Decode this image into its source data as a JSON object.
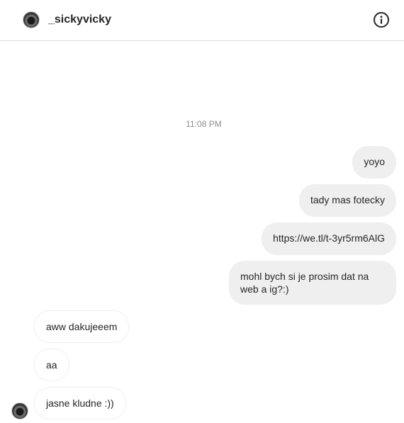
{
  "header": {
    "username": "_sickyvicky",
    "avatar_icon": "profile-avatar",
    "info_icon": "info-circle-icon"
  },
  "thread": {
    "timestamp": "11:08 PM",
    "messages": [
      {
        "direction": "outgoing",
        "text": "yoyo"
      },
      {
        "direction": "outgoing",
        "text": "tady mas fotecky"
      },
      {
        "direction": "outgoing",
        "text": "https://we.tl/t-3yr5rm6AlG"
      },
      {
        "direction": "outgoing",
        "text": "mohl bych si je prosim dat na web a ig?:)"
      },
      {
        "direction": "incoming",
        "text": "aww dakujeeem"
      },
      {
        "direction": "incoming",
        "text": "aa"
      },
      {
        "direction": "incoming",
        "text": "jasne kludne :))"
      }
    ]
  },
  "colors": {
    "outgoing_bubble": "#efefef",
    "incoming_border": "#efefef",
    "timestamp": "#8e8e8e",
    "divider": "#dbdbdb"
  }
}
